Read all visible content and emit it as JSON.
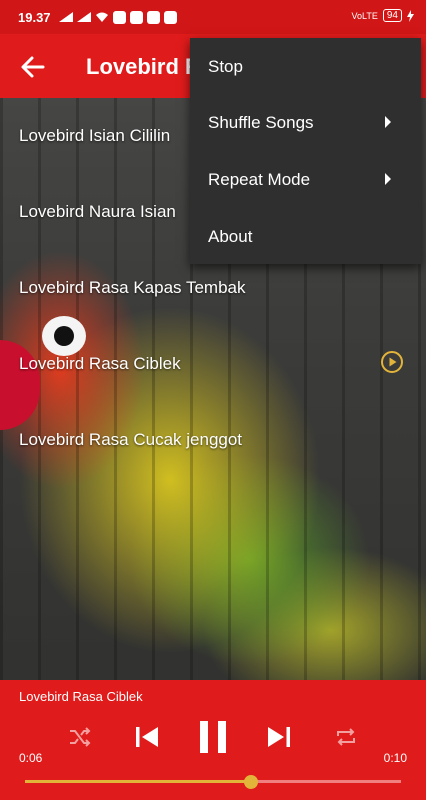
{
  "status": {
    "time": "19.37",
    "network": "VoLTE",
    "battery": "94"
  },
  "appbar": {
    "title": "Lovebird Rasa Ciblek",
    "back_icon": "arrow-left-icon"
  },
  "songs": [
    {
      "label": "Lovebird Isian Cililin"
    },
    {
      "label": "Lovebird Naura Isian"
    },
    {
      "label": "Lovebird Rasa Kapas Tembak"
    },
    {
      "label": "Lovebird Rasa Ciblek",
      "playing": true
    },
    {
      "label": "Lovebird Rasa Cucak jenggot"
    }
  ],
  "menu": {
    "items": [
      {
        "label": "Stop"
      },
      {
        "label": "Shuffle Songs",
        "submenu": true
      },
      {
        "label": "Repeat Mode",
        "submenu": true
      },
      {
        "label": "About"
      }
    ]
  },
  "player": {
    "now_playing": "Lovebird Rasa Ciblek",
    "elapsed": "0:06",
    "duration": "0:10",
    "progress": 0.6,
    "accent": "#e3b43a",
    "bar_color": "#e01b1b"
  }
}
